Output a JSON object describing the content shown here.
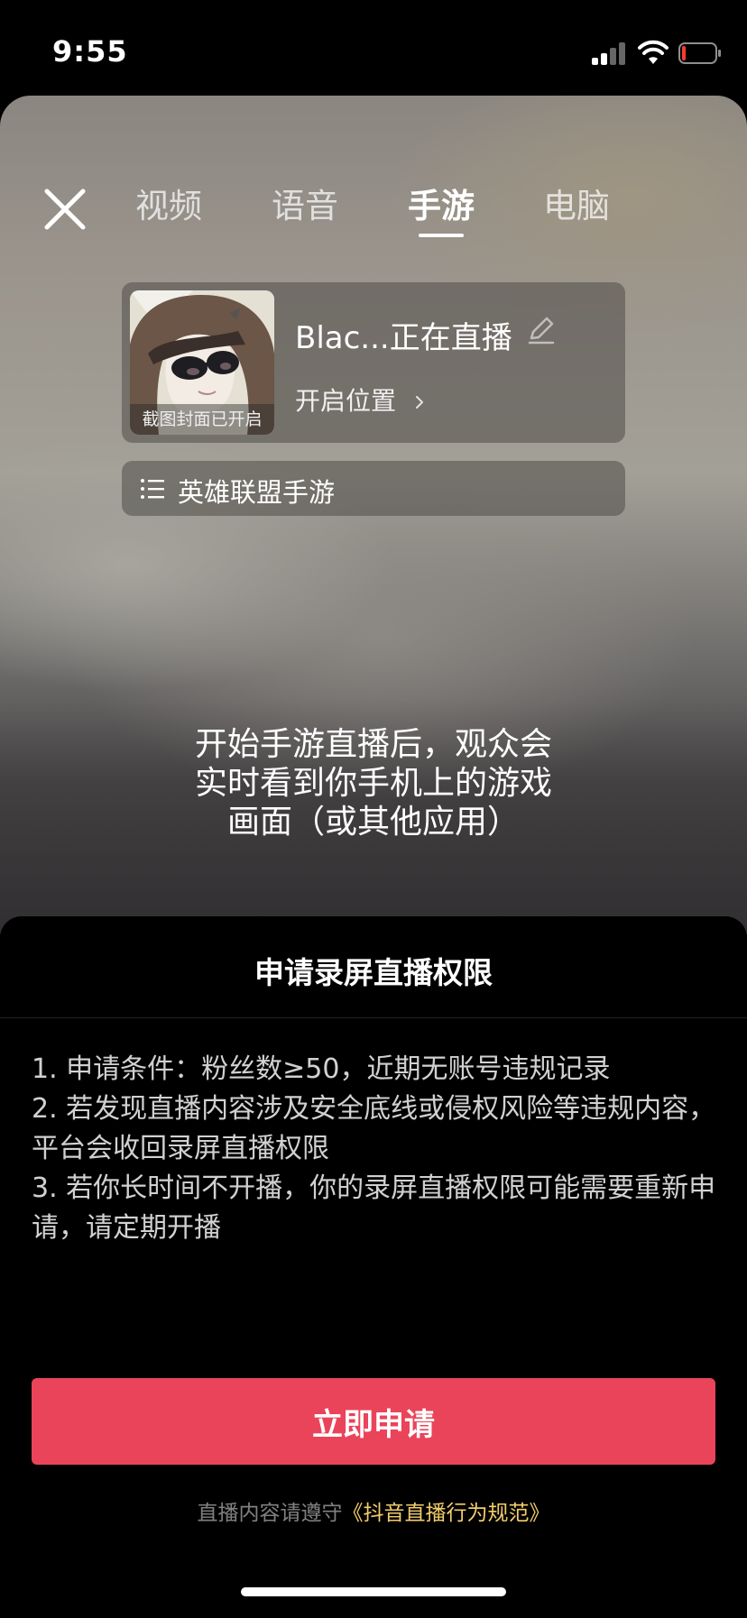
{
  "status_bar": {
    "time": "9:55",
    "battery_color": "#ff3b30",
    "icons": [
      "signal-icon",
      "wifi-icon",
      "battery-icon"
    ]
  },
  "preview": {
    "tabs": [
      {
        "label": "视频",
        "active": false
      },
      {
        "label": "语音",
        "active": false
      },
      {
        "label": "手游",
        "active": true
      },
      {
        "label": "电脑",
        "active": false
      }
    ],
    "info_card": {
      "cover_caption": "截图封面已开启",
      "title": "Blac...正在直播",
      "location_label": "开启位置"
    },
    "game_label": "英雄联盟手游",
    "description": "开始手游直播后，观众会实时看到你手机上的游戏画面（或其他应用）"
  },
  "sheet": {
    "title": "申请录屏直播权限",
    "rules": [
      "1. 申请条件：粉丝数≥50，近期无账号违规记录",
      "2. 若发现直播内容涉及安全底线或侵权风险等违规内容，平台会收回录屏直播权限",
      "3. 若你长时间不开播，你的录屏直播权限可能需要重新申请，请定期开播"
    ],
    "apply_button": "立即申请",
    "footer_prefix": "直播内容请遵守",
    "footer_link": "《抖音直播行为规范》"
  },
  "colors": {
    "accent": "#ea445a",
    "link": "#f3cd6b"
  }
}
